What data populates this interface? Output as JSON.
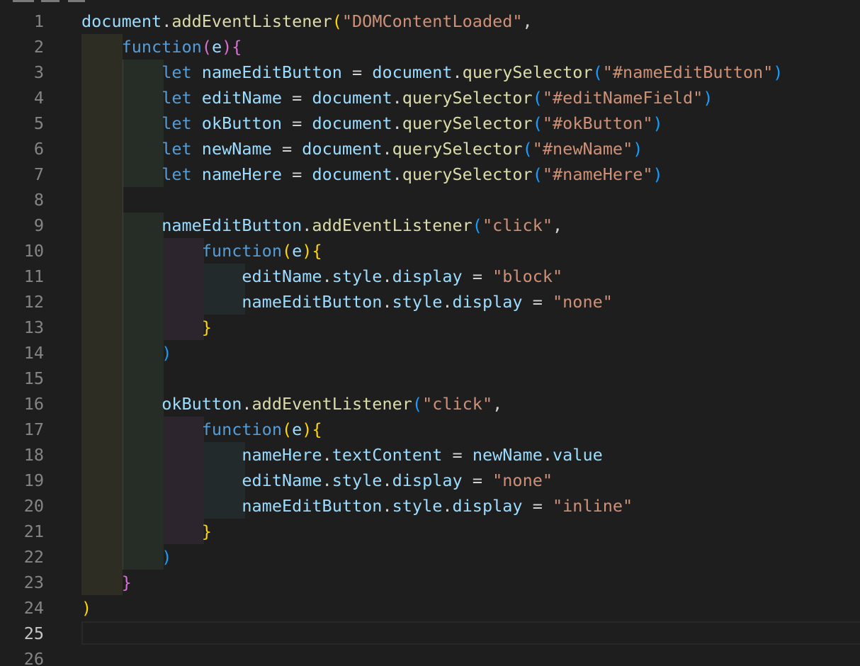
{
  "editor": {
    "language": "javascript",
    "theme": "dark",
    "active_line": 25,
    "lines": [
      {
        "num": "1",
        "tokens": [
          [
            "document",
            "var"
          ],
          [
            ".",
            "plain"
          ],
          [
            "addEventListener",
            "fn"
          ],
          [
            "(",
            "b1"
          ],
          [
            "\"DOMContentLoaded\"",
            "str"
          ],
          [
            ",",
            "plain"
          ]
        ]
      },
      {
        "num": "2",
        "tokens": [
          [
            "    ",
            "plain"
          ],
          [
            "function",
            "kw"
          ],
          [
            "(",
            "b2"
          ],
          [
            "e",
            "var"
          ],
          [
            ")",
            "b2"
          ],
          [
            "{",
            "b2"
          ]
        ]
      },
      {
        "num": "3",
        "tokens": [
          [
            "        ",
            "plain"
          ],
          [
            "let",
            "kw"
          ],
          [
            " ",
            "plain"
          ],
          [
            "nameEditButton",
            "var"
          ],
          [
            " = ",
            "plain"
          ],
          [
            "document",
            "var"
          ],
          [
            ".",
            "plain"
          ],
          [
            "querySelector",
            "fn"
          ],
          [
            "(",
            "b3"
          ],
          [
            "\"#nameEditButton\"",
            "str"
          ],
          [
            ")",
            "b3"
          ]
        ]
      },
      {
        "num": "4",
        "tokens": [
          [
            "        ",
            "plain"
          ],
          [
            "let",
            "kw"
          ],
          [
            " ",
            "plain"
          ],
          [
            "editName",
            "var"
          ],
          [
            " = ",
            "plain"
          ],
          [
            "document",
            "var"
          ],
          [
            ".",
            "plain"
          ],
          [
            "querySelector",
            "fn"
          ],
          [
            "(",
            "b3"
          ],
          [
            "\"#editNameField\"",
            "str"
          ],
          [
            ")",
            "b3"
          ]
        ]
      },
      {
        "num": "5",
        "tokens": [
          [
            "        ",
            "plain"
          ],
          [
            "let",
            "kw"
          ],
          [
            " ",
            "plain"
          ],
          [
            "okButton",
            "var"
          ],
          [
            " = ",
            "plain"
          ],
          [
            "document",
            "var"
          ],
          [
            ".",
            "plain"
          ],
          [
            "querySelector",
            "fn"
          ],
          [
            "(",
            "b3"
          ],
          [
            "\"#okButton\"",
            "str"
          ],
          [
            ")",
            "b3"
          ]
        ]
      },
      {
        "num": "6",
        "tokens": [
          [
            "        ",
            "plain"
          ],
          [
            "let",
            "kw"
          ],
          [
            " ",
            "plain"
          ],
          [
            "newName",
            "var"
          ],
          [
            " = ",
            "plain"
          ],
          [
            "document",
            "var"
          ],
          [
            ".",
            "plain"
          ],
          [
            "querySelector",
            "fn"
          ],
          [
            "(",
            "b3"
          ],
          [
            "\"#newName\"",
            "str"
          ],
          [
            ")",
            "b3"
          ]
        ]
      },
      {
        "num": "7",
        "tokens": [
          [
            "        ",
            "plain"
          ],
          [
            "let",
            "kw"
          ],
          [
            " ",
            "plain"
          ],
          [
            "nameHere",
            "var"
          ],
          [
            " = ",
            "plain"
          ],
          [
            "document",
            "var"
          ],
          [
            ".",
            "plain"
          ],
          [
            "querySelector",
            "fn"
          ],
          [
            "(",
            "b3"
          ],
          [
            "\"#nameHere\"",
            "str"
          ],
          [
            ")",
            "b3"
          ]
        ]
      },
      {
        "num": "8",
        "tokens": []
      },
      {
        "num": "9",
        "tokens": [
          [
            "        ",
            "plain"
          ],
          [
            "nameEditButton",
            "var"
          ],
          [
            ".",
            "plain"
          ],
          [
            "addEventListener",
            "fn"
          ],
          [
            "(",
            "b3"
          ],
          [
            "\"click\"",
            "str"
          ],
          [
            ",",
            "plain"
          ]
        ]
      },
      {
        "num": "10",
        "tokens": [
          [
            "            ",
            "plain"
          ],
          [
            "function",
            "kw"
          ],
          [
            "(",
            "b1"
          ],
          [
            "e",
            "var"
          ],
          [
            ")",
            "b1"
          ],
          [
            "{",
            "b1"
          ]
        ]
      },
      {
        "num": "11",
        "tokens": [
          [
            "                ",
            "plain"
          ],
          [
            "editName",
            "var"
          ],
          [
            ".",
            "plain"
          ],
          [
            "style",
            "var"
          ],
          [
            ".",
            "plain"
          ],
          [
            "display",
            "var"
          ],
          [
            " = ",
            "plain"
          ],
          [
            "\"block\"",
            "str"
          ]
        ]
      },
      {
        "num": "12",
        "tokens": [
          [
            "                ",
            "plain"
          ],
          [
            "nameEditButton",
            "var"
          ],
          [
            ".",
            "plain"
          ],
          [
            "style",
            "var"
          ],
          [
            ".",
            "plain"
          ],
          [
            "display",
            "var"
          ],
          [
            " = ",
            "plain"
          ],
          [
            "\"none\"",
            "str"
          ]
        ]
      },
      {
        "num": "13",
        "tokens": [
          [
            "            ",
            "plain"
          ],
          [
            "}",
            "b1"
          ]
        ]
      },
      {
        "num": "14",
        "tokens": [
          [
            "        ",
            "plain"
          ],
          [
            ")",
            "b3"
          ]
        ]
      },
      {
        "num": "15",
        "tokens": []
      },
      {
        "num": "16",
        "tokens": [
          [
            "        ",
            "plain"
          ],
          [
            "okButton",
            "var"
          ],
          [
            ".",
            "plain"
          ],
          [
            "addEventListener",
            "fn"
          ],
          [
            "(",
            "b3"
          ],
          [
            "\"click\"",
            "str"
          ],
          [
            ",",
            "plain"
          ]
        ]
      },
      {
        "num": "17",
        "tokens": [
          [
            "            ",
            "plain"
          ],
          [
            "function",
            "kw"
          ],
          [
            "(",
            "b1"
          ],
          [
            "e",
            "var"
          ],
          [
            ")",
            "b1"
          ],
          [
            "{",
            "b1"
          ]
        ]
      },
      {
        "num": "18",
        "tokens": [
          [
            "                ",
            "plain"
          ],
          [
            "nameHere",
            "var"
          ],
          [
            ".",
            "plain"
          ],
          [
            "textContent",
            "var"
          ],
          [
            " = ",
            "plain"
          ],
          [
            "newName",
            "var"
          ],
          [
            ".",
            "plain"
          ],
          [
            "value",
            "var"
          ]
        ]
      },
      {
        "num": "19",
        "tokens": [
          [
            "                ",
            "plain"
          ],
          [
            "editName",
            "var"
          ],
          [
            ".",
            "plain"
          ],
          [
            "style",
            "var"
          ],
          [
            ".",
            "plain"
          ],
          [
            "display",
            "var"
          ],
          [
            " = ",
            "plain"
          ],
          [
            "\"none\"",
            "str"
          ]
        ]
      },
      {
        "num": "20",
        "tokens": [
          [
            "                ",
            "plain"
          ],
          [
            "nameEditButton",
            "var"
          ],
          [
            ".",
            "plain"
          ],
          [
            "style",
            "var"
          ],
          [
            ".",
            "plain"
          ],
          [
            "display",
            "var"
          ],
          [
            " = ",
            "plain"
          ],
          [
            "\"inline\"",
            "str"
          ]
        ]
      },
      {
        "num": "21",
        "tokens": [
          [
            "            ",
            "plain"
          ],
          [
            "}",
            "b1"
          ]
        ]
      },
      {
        "num": "22",
        "tokens": [
          [
            "        ",
            "plain"
          ],
          [
            ")",
            "b3"
          ]
        ]
      },
      {
        "num": "23",
        "tokens": [
          [
            "    ",
            "plain"
          ],
          [
            "}",
            "b2"
          ]
        ]
      },
      {
        "num": "24",
        "tokens": [
          [
            ")",
            "b1"
          ]
        ]
      },
      {
        "num": "25",
        "tokens": []
      },
      {
        "num": "26",
        "tokens": []
      }
    ]
  },
  "colors": {
    "background": "#1e1e1e",
    "line_number": "#858585",
    "line_number_active": "#c6c6c6",
    "variable": "#9cdcfe",
    "function": "#dcdcaa",
    "string": "#ce9178",
    "keyword": "#569cd6",
    "bracket_gold": "#ffd700",
    "bracket_orchid": "#da70d6",
    "bracket_blue": "#179fff"
  }
}
